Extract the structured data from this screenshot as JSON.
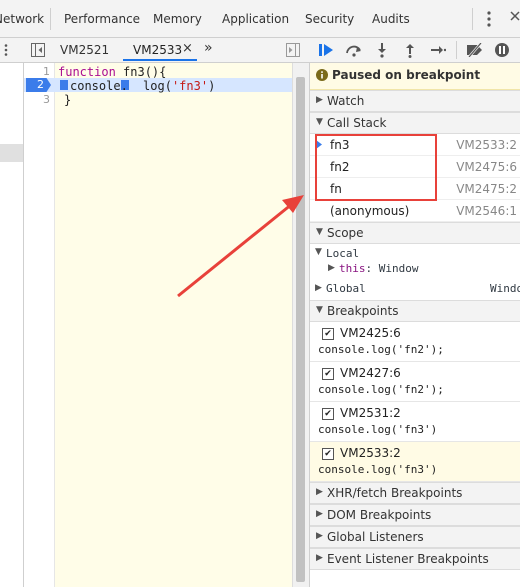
{
  "top_tabs": [
    "Network",
    "Performance",
    "Memory",
    "Application",
    "Security",
    "Audits"
  ],
  "row2": {
    "tab1": "VM2521",
    "tab2": "VM2533",
    "close_glyph": "×",
    "more_glyph": "»"
  },
  "editor": {
    "lines": [
      {
        "num": "1",
        "text_a": "function",
        "text_b": " fn3(){"
      },
      {
        "num": "2",
        "text_a": "console.",
        "text_b": "log(",
        "text_c": "'fn3'",
        "text_d": ")"
      },
      {
        "num": "3",
        "text": "}"
      }
    ]
  },
  "paused": {
    "text": "Paused on breakpoint"
  },
  "sections": {
    "watch": "Watch",
    "call_stack": "Call Stack",
    "scope": "Scope",
    "breakpoints": "Breakpoints",
    "xhr": "XHR/fetch Breakpoints",
    "dom": "DOM Breakpoints",
    "global_listeners": "Global Listeners",
    "event_listeners": "Event Listener Breakpoints"
  },
  "call_stack": [
    {
      "name": "fn3",
      "loc": "VM2533:2"
    },
    {
      "name": "fn2",
      "loc": "VM2475:6"
    },
    {
      "name": "fn",
      "loc": "VM2475:2"
    },
    {
      "name": "(anonymous)",
      "loc": "VM2546:1"
    }
  ],
  "scope": {
    "local": "Local",
    "this_key": "this",
    "this_sep": ":",
    "this_val": "Window",
    "global": "Global",
    "global_val": "Window"
  },
  "breakpoints": [
    {
      "where": "VM2425:6",
      "src": "console.log('fn2');"
    },
    {
      "where": "VM2427:6",
      "src": "console.log('fn2');"
    },
    {
      "where": "VM2531:2",
      "src": "console.log('fn3')"
    },
    {
      "where": "VM2533:2",
      "src": "console.log('fn3')"
    }
  ],
  "colors": {
    "accent": "#1a73e8",
    "highlight_box": "#e8413a",
    "paused_bg": "#fffbe5"
  }
}
